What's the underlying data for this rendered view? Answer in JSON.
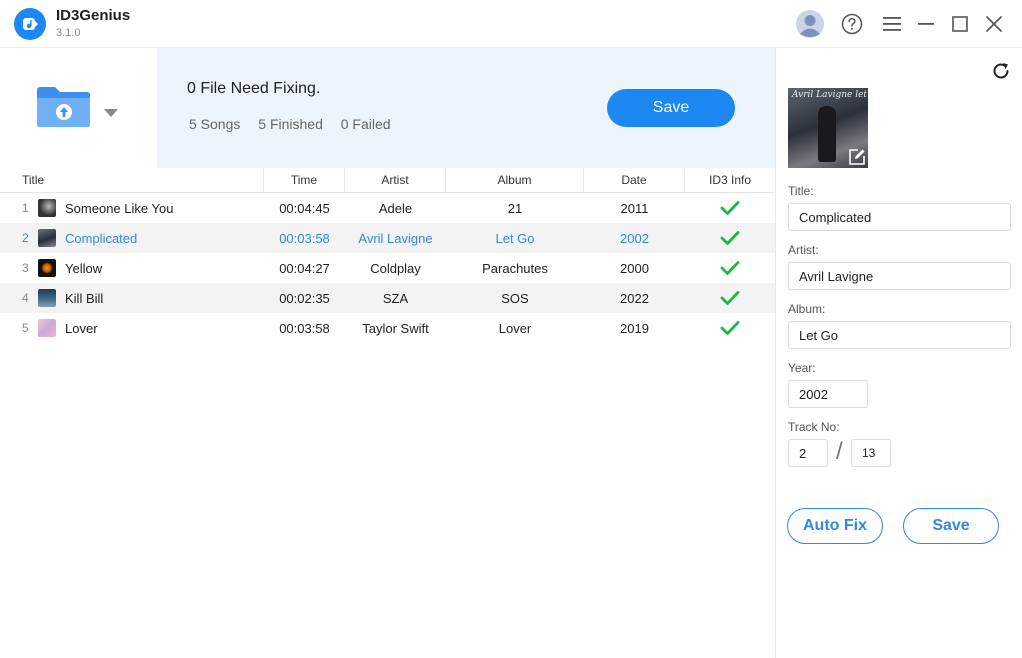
{
  "app": {
    "name": "ID3Genius",
    "version": "3.1.0"
  },
  "window_icons": [
    "avatar-icon",
    "help-icon",
    "menu-icon",
    "minimize-icon",
    "maximize-icon",
    "close-icon"
  ],
  "summary": {
    "title": "0 File Need Fixing.",
    "songs": "5 Songs",
    "finished": "5 Finished",
    "failed": "0 Failed",
    "save_label": "Save"
  },
  "table": {
    "headers": [
      "Title",
      "Time",
      "Artist",
      "Album",
      "Date",
      "ID3 Info"
    ],
    "rows": [
      {
        "index": "1",
        "title": "Someone Like You",
        "time": "00:04:45",
        "artist": "Adele",
        "album": "21",
        "date": "2011",
        "thumb_color": "#3a3a3a"
      },
      {
        "index": "2",
        "title": "Complicated",
        "time": "00:03:58",
        "artist": "Avril Lavigne",
        "album": "Let Go",
        "date": "2002",
        "thumb_color": "#4a5060"
      },
      {
        "index": "3",
        "title": "Yellow",
        "time": "00:04:27",
        "artist": "Coldplay",
        "album": "Parachutes",
        "date": "2000",
        "thumb_color": "#1a1208"
      },
      {
        "index": "4",
        "title": "Kill Bill",
        "time": "00:02:35",
        "artist": "SZA",
        "album": "SOS",
        "date": "2022",
        "thumb_color": "#28465e"
      },
      {
        "index": "5",
        "title": "Lover",
        "time": "00:03:58",
        "artist": "Taylor Swift",
        "album": "Lover",
        "date": "2019",
        "thumb_color": "#e9b6c6"
      }
    ]
  },
  "editor": {
    "cover_text": "Avril Lavigne   let Go",
    "title_label": "Title:",
    "title_value": "Complicated",
    "artist_label": "Artist:",
    "artist_value": "Avril Lavigne",
    "album_label": "Album:",
    "album_value": "Let Go",
    "year_label": "Year:",
    "year_value": "2002",
    "track_label": "Track No:",
    "track_value": "2",
    "track_total": "13",
    "auto_fix_label": "Auto Fix",
    "save_label": "Save"
  },
  "colors": {
    "accent": "#1e88f2",
    "selected_text": "#2f8ae0",
    "check": "#1fb54a",
    "summary_bg": "#eef4fc"
  }
}
